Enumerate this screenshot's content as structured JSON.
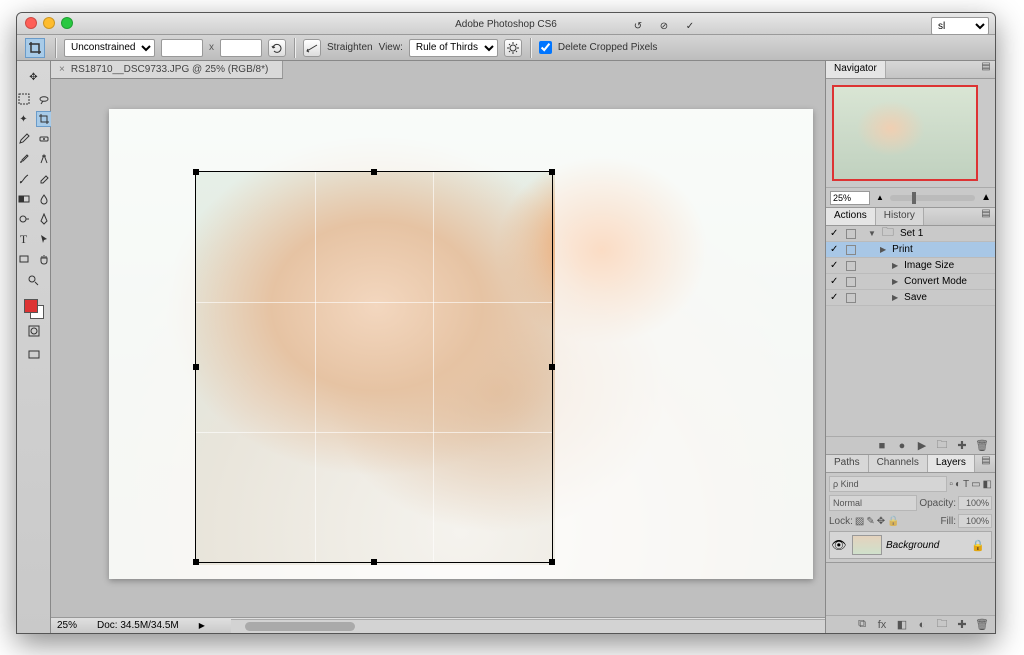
{
  "window": {
    "title": "Adobe Photoshop CS6"
  },
  "options": {
    "ratio_preset": "Unconstrained",
    "w": "",
    "h": "",
    "straighten_label": "Straighten",
    "view_label": "View:",
    "view_value": "Rule of Thirds",
    "delete_label": "Delete Cropped Pixels",
    "delete_checked": true,
    "workspace": "sl"
  },
  "document": {
    "tab_label": "RS18710__DSC9733.JPG @ 25% (RGB/8*)",
    "zoom": "25%",
    "doc_info": "Doc: 34.5M/34.5M"
  },
  "navigator": {
    "tab": "Navigator",
    "zoom": "25%"
  },
  "actions": {
    "tab_actions": "Actions",
    "tab_history": "History",
    "rows": [
      {
        "label": "Set 1",
        "depth": 0,
        "folder": true,
        "sel": false
      },
      {
        "label": "Print",
        "depth": 1,
        "folder": false,
        "sel": true
      },
      {
        "label": "Image Size",
        "depth": 2,
        "folder": false,
        "sel": false
      },
      {
        "label": "Convert Mode",
        "depth": 2,
        "folder": false,
        "sel": false
      },
      {
        "label": "Save",
        "depth": 2,
        "folder": false,
        "sel": false
      }
    ]
  },
  "layers": {
    "tab_paths": "Paths",
    "tab_channels": "Channels",
    "tab_layers": "Layers",
    "kind_label": "ρ Kind",
    "blend": "Normal",
    "opacity_label": "Opacity:",
    "opacity_value": "100%",
    "lock_label": "Lock:",
    "fill_label": "Fill:",
    "fill_value": "100%",
    "layer_name": "Background"
  }
}
